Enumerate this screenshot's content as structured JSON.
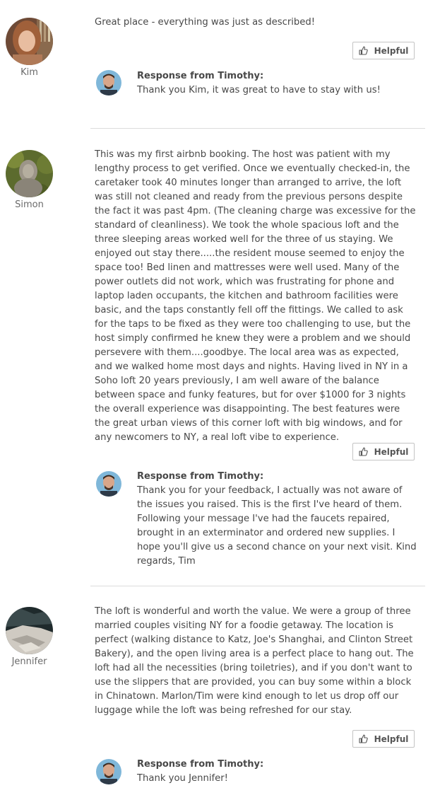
{
  "reviews": [
    {
      "reviewer": "Kim",
      "text": "Great place - everything was just as described!",
      "helpful_label": "Helpful",
      "response_heading": "Response from Timothy:",
      "response_text": "Thank you Kim, it was great to have to stay with us!"
    },
    {
      "reviewer": "Simon",
      "text": "This was my first airbnb booking. The host was patient with my lengthy process to get verified. Once we eventually checked-in, the caretaker took 40 minutes longer than arranged to arrive, the loft was still not cleaned and ready from the previous persons despite the fact it was past 4pm. (The cleaning charge was excessive for the standard of cleanliness). We took the whole spacious loft and the three sleeping areas worked well for the three of us staying. We enjoyed out stay there.....the resident mouse seemed to enjoy the space too! Bed linen and mattresses were well used. Many of the power outlets did not work, which was frustrating for phone and laptop laden occupants, the kitchen and bathroom facilities were basic, and the taps constantly fell off the fittings. We called to ask for the taps to be fixed as they were too challenging to use, but the host simply confirmed he knew they were a problem and we should persevere with them....goodbye. The local area was as expected, and we walked home most days and nights. Having lived in NY in a Soho loft 20 years previously, I am well aware of the balance between space and funky features, but for over $1000 for 3 nights the overall experience was disappointing. The best features were the great urban views of this corner loft with big windows, and for any newcomers to NY, a real loft vibe to experience.",
      "helpful_label": "Helpful",
      "response_heading": "Response from Timothy:",
      "response_text": "Thank you for your feedback, I actually was not aware of the issues you raised. This is the first I've heard of them. Following your message I've had the faucets repaired, brought in an exterminator and ordered new supplies. I hope you'll give us a second chance on your next visit. Kind regards, Tim"
    },
    {
      "reviewer": "Jennifer",
      "text": "The loft is wonderful and worth the value. We were a group of three married couples visiting NY for a foodie getaway. The location is perfect (walking distance to Katz, Joe's Shanghai, and Clinton Street Bakery), and the open living area is a perfect place to hang out. The loft had all the necessities (bring toiletries), and if you don't want to use the slippers that are provided, you can buy some within a block in Chinatown. Marlon/Tim were kind enough to let us drop off our luggage while the loft was being refreshed for our stay.",
      "helpful_label": "Helpful",
      "response_heading": "Response from Timothy:",
      "response_text": "Thank you Jennifer!"
    }
  ],
  "icons": {
    "helpful": "thumbs-up-icon"
  }
}
